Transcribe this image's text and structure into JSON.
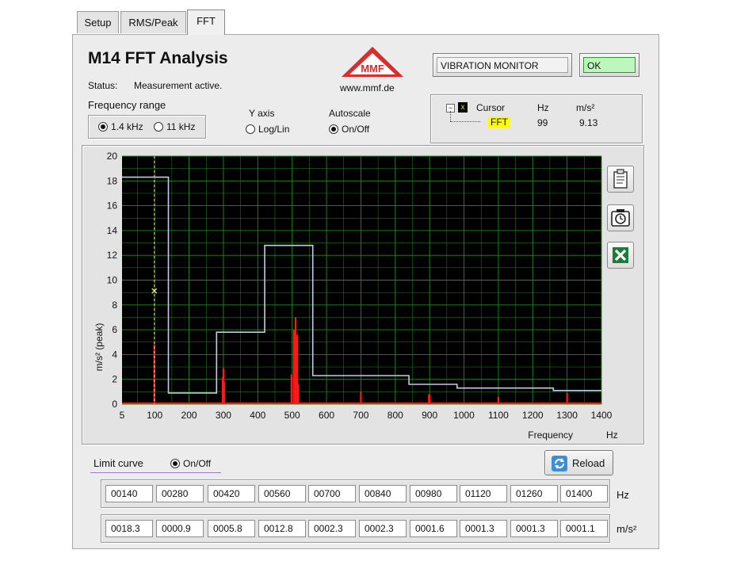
{
  "tabs": [
    {
      "label": "Setup"
    },
    {
      "label": "RMS/Peak"
    },
    {
      "label": "FFT"
    }
  ],
  "header": {
    "title": "M14 FFT Analysis",
    "status_label": "Status:",
    "status_value": "Measurement active.",
    "logo_text": "MMF",
    "website": "www.mmf.de",
    "monitor_button": "VIBRATION MONITOR",
    "ok_button": "OK"
  },
  "freq_range": {
    "label": "Frequency range",
    "option1": "1.4 kHz",
    "option2": "11 kHz",
    "selected": "1.4 kHz"
  },
  "y_axis": {
    "label": "Y axis",
    "option": "Log/Lin",
    "checked": false
  },
  "autoscale": {
    "label": "Autoscale",
    "option": "On/Off",
    "checked": true
  },
  "cursor": {
    "tree_label": "Cursor",
    "col_hz": "Hz",
    "col_unit": "m/s²",
    "name": "FFT",
    "hz": "99",
    "value": "9.13"
  },
  "limit_curve": {
    "label": "Limit curve",
    "toggle": "On/Off",
    "checked": true,
    "reload_button": "Reload",
    "freq_values": [
      "00140",
      "00280",
      "00420",
      "00560",
      "00700",
      "00840",
      "00980",
      "01120",
      "01260",
      "01400"
    ],
    "limit_values": [
      "0018.3",
      "0000.9",
      "0005.8",
      "0012.8",
      "0002.3",
      "0002.3",
      "0001.6",
      "0001.3",
      "0001.3",
      "0001.1"
    ],
    "freq_unit": "Hz",
    "value_unit": "m/s²"
  },
  "colors": {
    "plot_bg": "#000000",
    "grid": "#1f8a1f",
    "limit_line": "#c8c8e8",
    "spectrum": "#ff1a1a",
    "cursor_line": "#e8e870",
    "highlight": "#ffff00"
  },
  "icons": [
    "clipboard-icon",
    "camera-timer-icon",
    "excel-export-icon",
    "tree-expander-icon",
    "reload-icon"
  ],
  "chart_data": {
    "type": "line",
    "xlabel": "Frequency",
    "xunit": "Hz",
    "ylabel": "m/s² (peak)",
    "xlim": [
      5,
      1400
    ],
    "ylim": [
      0,
      20
    ],
    "x_ticks": [
      5,
      100,
      200,
      300,
      400,
      500,
      600,
      700,
      800,
      900,
      1000,
      1100,
      1200,
      1300,
      1400
    ],
    "y_ticks": [
      0,
      2,
      4,
      6,
      8,
      10,
      12,
      14,
      16,
      18,
      20
    ],
    "grid": true,
    "cursor_x": 99,
    "cursor_y": 9.13,
    "series": [
      {
        "type": "step",
        "x": [
          5,
          140,
          140,
          280,
          280,
          420,
          420,
          560,
          560,
          840,
          840,
          980,
          980,
          1260,
          1260,
          1400
        ],
        "y": [
          18.3,
          18.3,
          0.9,
          0.9,
          5.8,
          5.8,
          12.8,
          12.8,
          2.3,
          2.3,
          1.6,
          1.6,
          1.3,
          1.3,
          1.1,
          1.1
        ]
      },
      {
        "type": "spectrum",
        "x": [
          99,
          298,
          300,
          302,
          498,
          505,
          510,
          515,
          518,
          700,
          898,
          900,
          1100,
          1300
        ],
        "y": [
          4.8,
          2.2,
          2.9,
          1.8,
          2.4,
          6.0,
          7.0,
          5.6,
          1.6,
          1.0,
          0.8,
          0.8,
          0.6,
          0.9
        ]
      }
    ]
  }
}
